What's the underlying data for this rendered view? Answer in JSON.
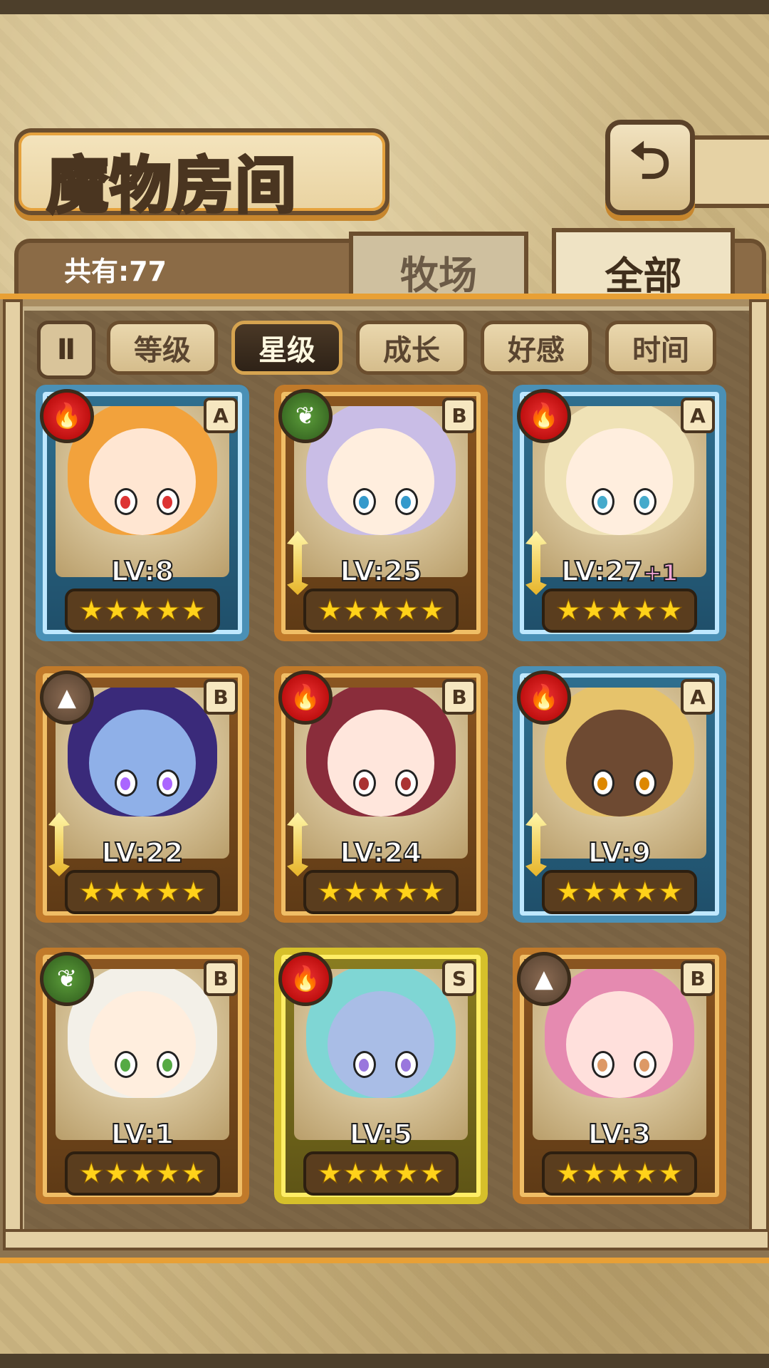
{
  "header": {
    "title": "魔物房间",
    "back_icon": "return-arrow-icon"
  },
  "summary": {
    "total_label": "共有:77"
  },
  "tabs": [
    {
      "label": "牧场",
      "active": false
    },
    {
      "label": "全部",
      "active": true
    }
  ],
  "sort": {
    "toggle_label": "Ⅱ",
    "buttons": [
      {
        "label": "等级",
        "active": false
      },
      {
        "label": "星级",
        "active": true
      },
      {
        "label": "成长",
        "active": false
      },
      {
        "label": "好感",
        "active": false
      },
      {
        "label": "时间",
        "active": false
      }
    ]
  },
  "colors": {
    "accent": "#e8a035",
    "rank_A_frame": "#4a90b6",
    "rank_B_frame": "#c17a2a",
    "rank_S_frame": "#d6c02a",
    "star": "#ffd21a"
  },
  "monsters": [
    {
      "element": "fire",
      "rank": "A",
      "level": "LV:8",
      "bonus": "",
      "stars": "★★★★★",
      "weapon": false,
      "hair": "#f2a23c",
      "skin": "#ffe6d2",
      "eye": "#d33"
    },
    {
      "element": "leaf",
      "rank": "B",
      "level": "LV:25",
      "bonus": "",
      "stars": "★★★★★",
      "weapon": true,
      "hair": "#c9bde6",
      "skin": "#ffeede",
      "eye": "#39c"
    },
    {
      "element": "fire",
      "rank": "A",
      "level": "LV:27",
      "bonus": "+1",
      "stars": "★★★★★",
      "weapon": true,
      "hair": "#efe2b6",
      "skin": "#ffeede",
      "eye": "#4ac"
    },
    {
      "element": "earth",
      "rank": "B",
      "level": "LV:22",
      "bonus": "",
      "stars": "★★★★★",
      "weapon": true,
      "hair": "#3a2a7a",
      "skin": "#8fb0e8",
      "eye": "#a6f"
    },
    {
      "element": "fire",
      "rank": "B",
      "level": "LV:24",
      "bonus": "",
      "stars": "★★★★★",
      "weapon": true,
      "hair": "#8a2d3b",
      "skin": "#ffe6dc",
      "eye": "#a33"
    },
    {
      "element": "fire",
      "rank": "A",
      "level": "LV:9",
      "bonus": "",
      "stars": "★★★★★",
      "weapon": true,
      "hair": "#e6c36b",
      "skin": "#6e4a32",
      "eye": "#d80"
    },
    {
      "element": "leaf",
      "rank": "B",
      "level": "LV:1",
      "bonus": "",
      "stars": "★★★★★",
      "weapon": false,
      "hair": "#f3f0e8",
      "skin": "#ffeede",
      "eye": "#5a4"
    },
    {
      "element": "fire",
      "rank": "S",
      "level": "LV:5",
      "bonus": "",
      "stars": "★★★★★",
      "weapon": false,
      "hair": "#7fd6d4",
      "skin": "#a9bde6",
      "eye": "#97d"
    },
    {
      "element": "earth",
      "rank": "B",
      "level": "LV:3",
      "bonus": "",
      "stars": "★★★★★",
      "weapon": false,
      "hair": "#e58ab0",
      "skin": "#ffe0dc",
      "eye": "#d96"
    }
  ]
}
